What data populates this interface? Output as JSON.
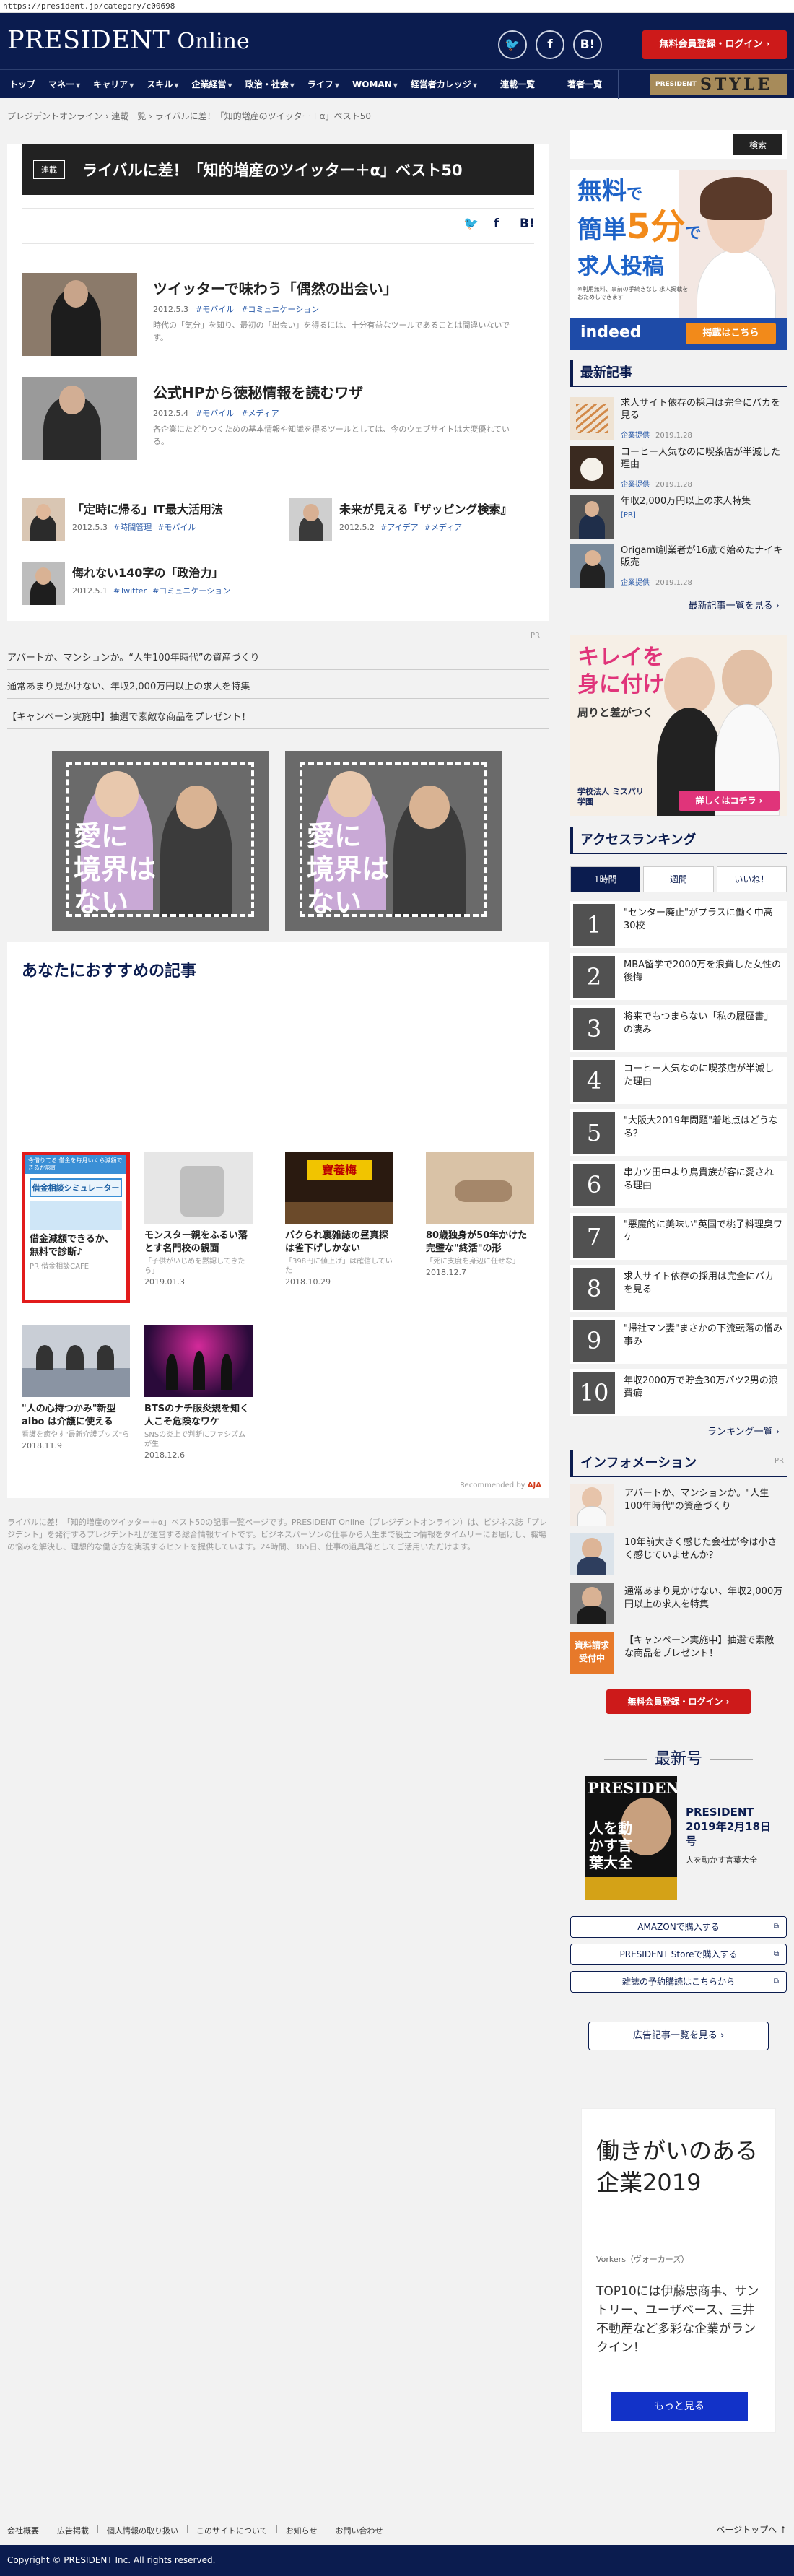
{
  "url": "https://president.jp/category/c00698",
  "header": {
    "logo_main": "PRESIDENT",
    "logo_sub": "Online",
    "sns": [
      "twitter-icon",
      "facebook-icon",
      "hatena-icon"
    ],
    "hatena_label": "B!",
    "login_label": "無料会員登録・ログイン ›"
  },
  "nav": {
    "items": [
      "トップ",
      "マネー",
      "キャリア",
      "スキル",
      "企業経営",
      "政治・社会",
      "ライフ",
      "WOMAN",
      "経営者カレッジ",
      "連載一覧",
      "著者一覧"
    ],
    "style_prefix": "PRESIDENT",
    "style_label": "STYLE"
  },
  "breadcrumb": "プレジデントオンライン  ›  連載一覧  ›  ライバルに差！「知的増産のツイッター＋α」ベスト50",
  "series": {
    "tag": "連載",
    "title": "ライバルに差！「知的増産のツイッター＋α」ベスト50"
  },
  "articles_big": [
    {
      "title": "ツイッターで味わう「偶然の出会い」",
      "date": "2012.5.3",
      "tags": [
        "#モバイル",
        "#コミュニケーション"
      ],
      "desc": "時代の「気分」を知り、最初の「出会い」を得るには、十分有益なツールであることは間違いないです。"
    },
    {
      "title": "公式HPから徳秘情報を読むワザ",
      "date": "2012.5.4",
      "tags": [
        "#モバイル",
        "#メディア"
      ],
      "desc": "各企業にたどりつくための基本情報や知識を得るツールとしては、今のウェブサイトは大変優れている。"
    }
  ],
  "articles_small": [
    {
      "title": "「定時に帰る」IT最大活用法",
      "date": "2012.5.3",
      "tags": [
        "#時間管理",
        "#モバイル"
      ]
    },
    {
      "title": "未来が見える『ザッピング検索』",
      "date": "2012.5.2",
      "tags": [
        "#アイデア",
        "#メディア"
      ]
    },
    {
      "title": "侮れない140字の「政治力」",
      "date": "2012.5.1",
      "tags": [
        "#Twitter",
        "#コミュニケーション"
      ]
    }
  ],
  "pr": {
    "label": "PR",
    "links": [
      "アパートか、マンションか。“人生100年時代”の資産づくり",
      "通常あまり見かけない、年収2,000万円以上の求人を特集",
      "【キャンペーン実施中】抽選で素敵な商品をプレゼント！"
    ],
    "banner_text": "愛に\n境界は\nない"
  },
  "recommend": {
    "title": "あなたにおすすめの記事",
    "ad_card": {
      "header": "今借りてる 借金を毎月いくら減額できるか診断",
      "box": "借金相談シミュレーター",
      "title": "借金減額できるか、無料で診断♪",
      "src": "PR 借金相談CAFE"
    },
    "items": [
      {
        "title": "モンスター親をふるい落とす名門校の親面",
        "sub": "「子供がいじめを黙認してきたら」",
        "date": "2019.01.3"
      },
      {
        "title": "バクられ裏雑誌の昼真探は雀下げしかない",
        "sub": "「398円に値上げ」は確信していた",
        "date": "2018.10.29"
      },
      {
        "title": "80歳独身が50年かけた完璧な\"終活\"の形",
        "sub": "「死に支度を身辺に任せな」",
        "date": "2018.12.7"
      },
      {
        "title": "\"人の心持つかみ\"新型aibo は介護に使える",
        "sub": "看護を癒やす\"最新介護ブッズ\"ら",
        "date": "2018.11.9"
      },
      {
        "title": "BTSのナチ服炎規を知く人こそ危険なワケ",
        "sub": "SNSの炎上で判断にファシズムが生",
        "date": "2018.12.6"
      }
    ],
    "by": "Recommended by",
    "by_brand": "AJA"
  },
  "footer_note": "ライバルに差！「知的増産のツイッター＋α」ベスト50の記事一覧ページです。PRESIDENT Online（プレジデントオンライン）は、ビジネス誌「プレジデント」を発行するプレジデント社が運営する総合情報サイトです。ビジネスパーソンの仕事から人生まで役立つ情報をタイムリーにお届けし、職場の悩みを解決し、理想的な働き方を実現するヒントを提供しています。24時間、365日、仕事の道具箱としてご活用いただけます。",
  "sidebar": {
    "search_label": "検索",
    "ad_top": {
      "l1": "無料",
      "l2": "で",
      "l3": "簡単",
      "l4": "5分",
      "l5": "で",
      "l6": "求人投稿",
      "small": "※利用無料、事前の手続きなし 求人掲載をおためしできます",
      "brand": "indeed",
      "btn": "掲載はこちら"
    },
    "latest_title": "最新記事",
    "latest": [
      {
        "title": "求人サイト依存の採用は完全にバカを見る",
        "src": "企業提供",
        "date": "2019.1.28"
      },
      {
        "title": "コーヒー人気なのに喫茶店が半減した理由",
        "src": "企業提供",
        "date": "2019.1.28"
      },
      {
        "title": "年収2,000万円以上の求人特集",
        "src": "[PR]",
        "date": ""
      },
      {
        "title": "Origami創業者が16歳で始めたナイキ販売",
        "src": "企業提供",
        "date": "2019.1.28"
      }
    ],
    "latest_more": "最新記事一覧を見る ›",
    "ad_mid": {
      "l1": "キレイを",
      "l2": "身に付け",
      "l3": "周りと差がつく",
      "school": "学校法人 ミスパリ学園",
      "btn": "詳しくはコチラ ›"
    },
    "ranking_title": "アクセスランキング",
    "ranking_tabs": [
      "1時間",
      "週間",
      "いいね！"
    ],
    "ranking": [
      "\"センター廃止\"がプラスに働く中高30校",
      "MBA留学で2000万を浪費した女性の後悔",
      "将来でもつまらない「私の履歴書」の凄み",
      "コーヒー人気なのに喫茶店が半減した理由",
      "\"大阪大2019年問題\"着地点はどうなる？",
      "串カツ田中より鳥貴族が客に愛される理由",
      "\"悪魔的に美味い\"英国で桃子料理臭ワケ",
      "求人サイト依存の採用は完全にバカを見る",
      "\"帰社マン妻\"まさかの下流転落の憎み事み",
      "年収2000万で貯金30万バツ2男の浪費癖"
    ],
    "ranking_more": "ランキング一覧 ›",
    "info_title": "インフォメーション",
    "info_pr": "PR",
    "info": [
      "アパートか、マンションか。\"人生100年時代\"の資産づくり",
      "10年前大きく感じた会社が今は小さく感じていませんか？",
      "通常あまり見かけない、年収2,000万円以上の求人を特集",
      "【キャンペーン実施中】抽選で素敵な商品をプレゼント！"
    ],
    "info_badge": "資料請求 受付中",
    "login_label": "無料会員登録・ログイン ›",
    "latest_issue_title": "最新号",
    "issue": {
      "mag": "PRESIDENT",
      "date_line": "PRESIDENT 2019年2月18日号",
      "cover_lead": "人を動かす言葉大全",
      "feature": "人を動かす言葉大全"
    },
    "buy_links": [
      "AMAZONで購入する",
      "PRESIDENT Storeで購入する",
      "雑誌の予約購読はこちらから"
    ],
    "ad_list": "広告記事一覧を見る ›",
    "ad_rect": {
      "title": "働きがいのある企業2019",
      "src": "Vorkers（ヴォーカーズ）",
      "body": "TOP10には伊藤忠商事、サントリー、ユーザベース、三井不動産など多彩な企業がランクイン！",
      "btn": "もっと見る"
    }
  },
  "footer": {
    "links": [
      "会社概要",
      "広告掲載",
      "個人情報の取り扱い",
      "このサイトについて",
      "お知らせ",
      "お問い合わせ"
    ],
    "pagetop": "ページトップへ ↑",
    "copyright": "Copyright © PRESIDENT Inc. All rights reserved."
  }
}
